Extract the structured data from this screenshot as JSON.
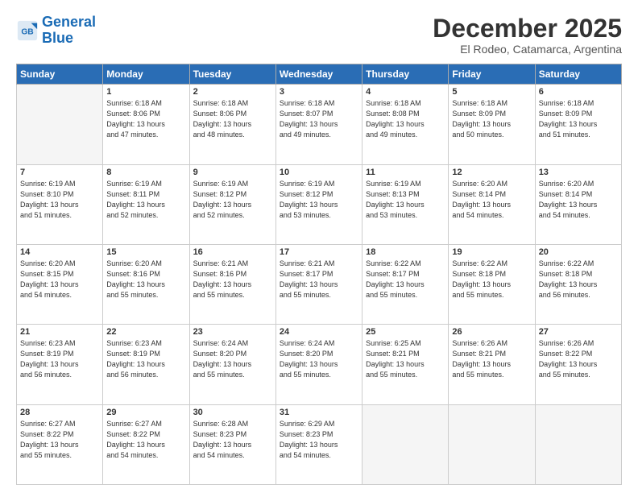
{
  "logo": {
    "line1": "General",
    "line2": "Blue"
  },
  "title": "December 2025",
  "subtitle": "El Rodeo, Catamarca, Argentina",
  "days_of_week": [
    "Sunday",
    "Monday",
    "Tuesday",
    "Wednesday",
    "Thursday",
    "Friday",
    "Saturday"
  ],
  "weeks": [
    [
      {
        "num": "",
        "empty": true
      },
      {
        "num": "1",
        "sunrise": "6:18 AM",
        "sunset": "8:06 PM",
        "daylight": "13 hours and 47 minutes."
      },
      {
        "num": "2",
        "sunrise": "6:18 AM",
        "sunset": "8:06 PM",
        "daylight": "13 hours and 48 minutes."
      },
      {
        "num": "3",
        "sunrise": "6:18 AM",
        "sunset": "8:07 PM",
        "daylight": "13 hours and 49 minutes."
      },
      {
        "num": "4",
        "sunrise": "6:18 AM",
        "sunset": "8:08 PM",
        "daylight": "13 hours and 49 minutes."
      },
      {
        "num": "5",
        "sunrise": "6:18 AM",
        "sunset": "8:09 PM",
        "daylight": "13 hours and 50 minutes."
      },
      {
        "num": "6",
        "sunrise": "6:18 AM",
        "sunset": "8:09 PM",
        "daylight": "13 hours and 51 minutes."
      }
    ],
    [
      {
        "num": "7",
        "sunrise": "6:19 AM",
        "sunset": "8:10 PM",
        "daylight": "13 hours and 51 minutes."
      },
      {
        "num": "8",
        "sunrise": "6:19 AM",
        "sunset": "8:11 PM",
        "daylight": "13 hours and 52 minutes."
      },
      {
        "num": "9",
        "sunrise": "6:19 AM",
        "sunset": "8:12 PM",
        "daylight": "13 hours and 52 minutes."
      },
      {
        "num": "10",
        "sunrise": "6:19 AM",
        "sunset": "8:12 PM",
        "daylight": "13 hours and 53 minutes."
      },
      {
        "num": "11",
        "sunrise": "6:19 AM",
        "sunset": "8:13 PM",
        "daylight": "13 hours and 53 minutes."
      },
      {
        "num": "12",
        "sunrise": "6:20 AM",
        "sunset": "8:14 PM",
        "daylight": "13 hours and 54 minutes."
      },
      {
        "num": "13",
        "sunrise": "6:20 AM",
        "sunset": "8:14 PM",
        "daylight": "13 hours and 54 minutes."
      }
    ],
    [
      {
        "num": "14",
        "sunrise": "6:20 AM",
        "sunset": "8:15 PM",
        "daylight": "13 hours and 54 minutes."
      },
      {
        "num": "15",
        "sunrise": "6:20 AM",
        "sunset": "8:16 PM",
        "daylight": "13 hours and 55 minutes."
      },
      {
        "num": "16",
        "sunrise": "6:21 AM",
        "sunset": "8:16 PM",
        "daylight": "13 hours and 55 minutes."
      },
      {
        "num": "17",
        "sunrise": "6:21 AM",
        "sunset": "8:17 PM",
        "daylight": "13 hours and 55 minutes."
      },
      {
        "num": "18",
        "sunrise": "6:22 AM",
        "sunset": "8:17 PM",
        "daylight": "13 hours and 55 minutes."
      },
      {
        "num": "19",
        "sunrise": "6:22 AM",
        "sunset": "8:18 PM",
        "daylight": "13 hours and 55 minutes."
      },
      {
        "num": "20",
        "sunrise": "6:22 AM",
        "sunset": "8:18 PM",
        "daylight": "13 hours and 56 minutes."
      }
    ],
    [
      {
        "num": "21",
        "sunrise": "6:23 AM",
        "sunset": "8:19 PM",
        "daylight": "13 hours and 56 minutes."
      },
      {
        "num": "22",
        "sunrise": "6:23 AM",
        "sunset": "8:19 PM",
        "daylight": "13 hours and 56 minutes."
      },
      {
        "num": "23",
        "sunrise": "6:24 AM",
        "sunset": "8:20 PM",
        "daylight": "13 hours and 55 minutes."
      },
      {
        "num": "24",
        "sunrise": "6:24 AM",
        "sunset": "8:20 PM",
        "daylight": "13 hours and 55 minutes."
      },
      {
        "num": "25",
        "sunrise": "6:25 AM",
        "sunset": "8:21 PM",
        "daylight": "13 hours and 55 minutes."
      },
      {
        "num": "26",
        "sunrise": "6:26 AM",
        "sunset": "8:21 PM",
        "daylight": "13 hours and 55 minutes."
      },
      {
        "num": "27",
        "sunrise": "6:26 AM",
        "sunset": "8:22 PM",
        "daylight": "13 hours and 55 minutes."
      }
    ],
    [
      {
        "num": "28",
        "sunrise": "6:27 AM",
        "sunset": "8:22 PM",
        "daylight": "13 hours and 55 minutes."
      },
      {
        "num": "29",
        "sunrise": "6:27 AM",
        "sunset": "8:22 PM",
        "daylight": "13 hours and 54 minutes."
      },
      {
        "num": "30",
        "sunrise": "6:28 AM",
        "sunset": "8:23 PM",
        "daylight": "13 hours and 54 minutes."
      },
      {
        "num": "31",
        "sunrise": "6:29 AM",
        "sunset": "8:23 PM",
        "daylight": "13 hours and 54 minutes."
      },
      {
        "num": "",
        "empty": true
      },
      {
        "num": "",
        "empty": true
      },
      {
        "num": "",
        "empty": true
      }
    ]
  ]
}
